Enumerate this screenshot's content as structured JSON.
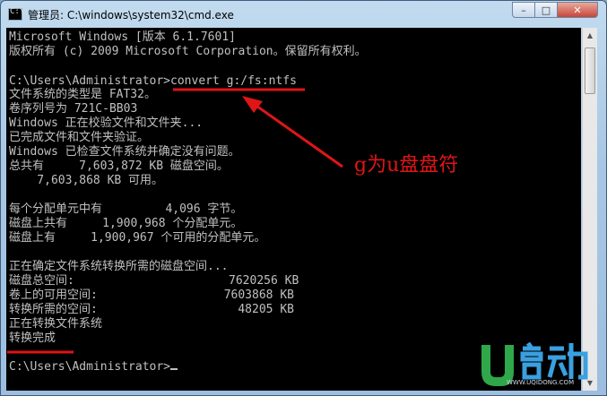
{
  "window": {
    "title": "管理员: C:\\windows\\system32\\cmd.exe",
    "icon": "cmd-icon",
    "controls": {
      "minimize": "–",
      "maximize": "□",
      "close": "✕"
    }
  },
  "console": {
    "lines": [
      "Microsoft Windows [版本 6.1.7601]",
      "版权所有 (c) 2009 Microsoft Corporation。保留所有权利。",
      "",
      "C:\\Users\\Administrator>convert g:/fs:ntfs",
      "文件系统的类型是 FAT32。",
      "卷序列号为 721C-BB03",
      "Windows 正在校验文件和文件夹...",
      "已完成文件和文件夹验证。",
      "Windows 已检查文件系统并确定没有问题。",
      "总共有     7,603,872 KB 磁盘空间。",
      "    7,603,868 KB 可用。",
      "",
      "每个分配单元中有         4,096 字节。",
      "磁盘上共有     1,900,968 个分配单元。",
      "磁盘上有     1,900,967 个可用的分配单元。",
      "",
      "正在确定文件系统转换所需的磁盘空间...",
      "磁盘总空间:                      7620256 KB",
      "卷上的可用空间:                  7603868 KB",
      "转换所需的空间:                    48205 KB",
      "正在转换文件系统",
      "转换完成",
      "",
      "C:\\Users\\Administrator>"
    ]
  },
  "annotation": {
    "text": "g为u盘盘符",
    "color": "#e01515"
  },
  "watermark": {
    "brand": "U启动",
    "site": "WWW.UQIDONG.COM"
  },
  "colors": {
    "console_bg": "#000000",
    "console_fg": "#c0c0c0",
    "highlight": "#e01515",
    "logo_green": "#2ea84b",
    "logo_blue": "#3aa0e0"
  }
}
